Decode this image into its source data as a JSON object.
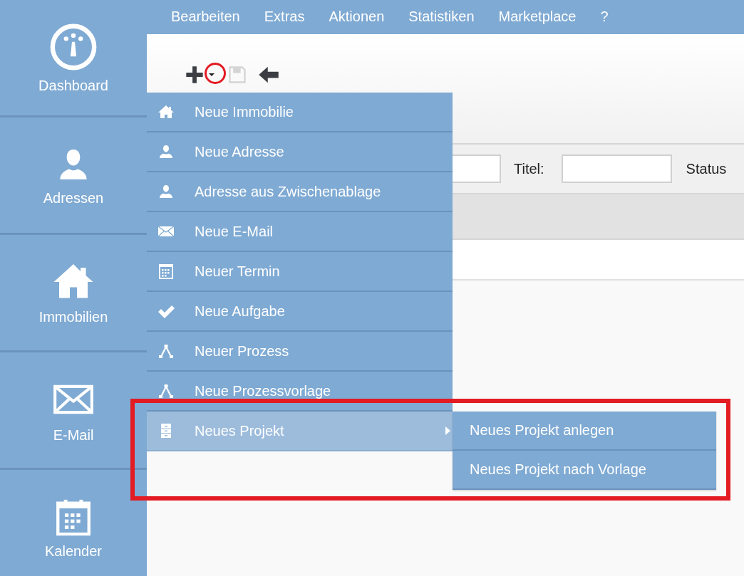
{
  "menubar": {
    "items": [
      "Bearbeiten",
      "Extras",
      "Aktionen",
      "Statistiken",
      "Marketplace",
      "?"
    ]
  },
  "sidebar": {
    "items": [
      {
        "label": "Dashboard"
      },
      {
        "label": "Adressen"
      },
      {
        "label": "Immobilien"
      },
      {
        "label": "E-Mail"
      },
      {
        "label": "Kalender"
      }
    ]
  },
  "toolbar": {
    "buttons": [
      {
        "kind": "add",
        "disabled": false
      },
      {
        "kind": "dropdown",
        "disabled": false
      },
      {
        "kind": "save",
        "disabled": true
      },
      {
        "kind": "back",
        "disabled": false
      }
    ]
  },
  "filter": {
    "title_label": "Titel:",
    "status_label": "Status"
  },
  "new_menu": {
    "items": [
      {
        "label": "Neue Immobilie",
        "selected": false,
        "has_submenu": false
      },
      {
        "label": "Neue Adresse",
        "selected": false,
        "has_submenu": false
      },
      {
        "label": "Adresse aus Zwischenablage",
        "selected": false,
        "has_submenu": false
      },
      {
        "label": "Neue E-Mail",
        "selected": false,
        "has_submenu": false
      },
      {
        "label": "Neuer Termin",
        "selected": false,
        "has_submenu": false
      },
      {
        "label": "Neue Aufgabe",
        "selected": false,
        "has_submenu": false
      },
      {
        "label": "Neuer Prozess",
        "selected": false,
        "has_submenu": false
      },
      {
        "label": "Neue Prozessvorlage",
        "selected": false,
        "has_submenu": false
      },
      {
        "label": "Neues Projekt",
        "selected": true,
        "has_submenu": true
      }
    ]
  },
  "submenu": {
    "items": [
      {
        "label": "Neues Projekt anlegen",
        "selected": false
      },
      {
        "label": "Neues Projekt nach Vorlage",
        "selected": false
      }
    ]
  }
}
